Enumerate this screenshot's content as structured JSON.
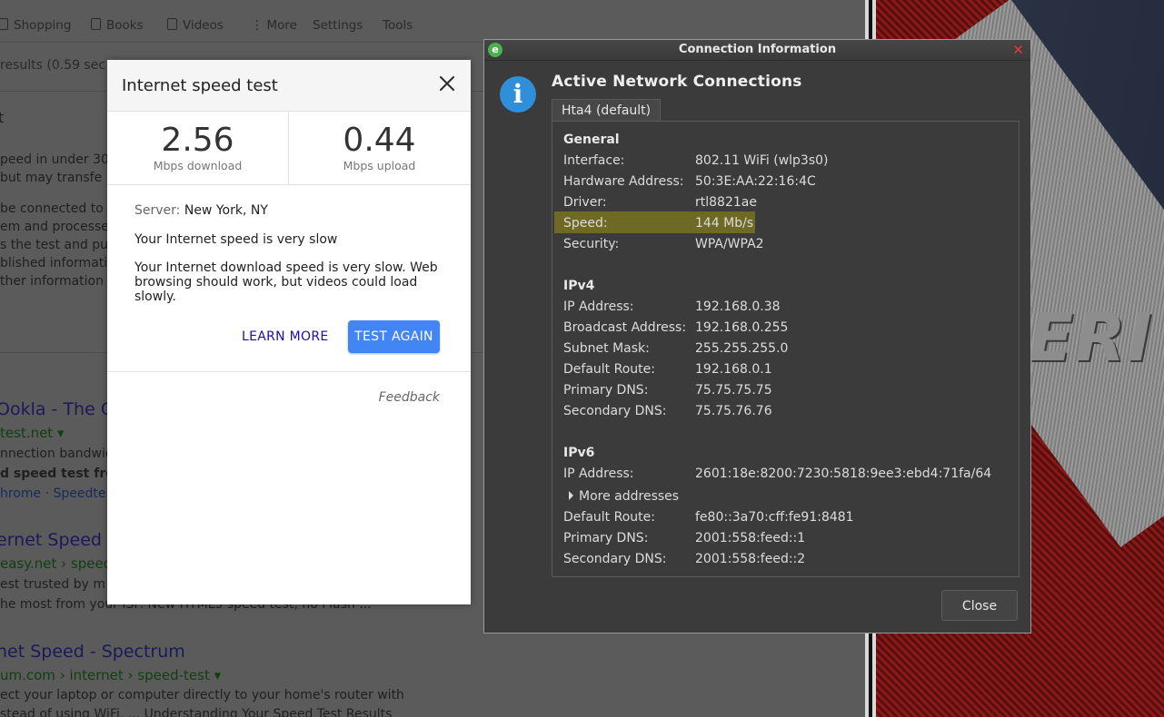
{
  "browser": {
    "tabs": [
      "Shopping",
      "Books",
      "Videos",
      "More",
      "Settings",
      "Tools"
    ],
    "results_stats": "results (0.59 sec",
    "snippet_lines": [
      "peed in under 30",
      "but may transfe",
      "be connected to",
      "em and processe",
      "s the test and pu",
      "blished informatio",
      "ther information"
    ],
    "result1_title": "Ookla - The G",
    "result1_url": "test.net",
    "result1_line1": "nnection bandwid",
    "result1_line2": "d speed test fro",
    "result1_links": "hrome · Speedte",
    "result2_title": "ernet Speed",
    "result2_url": "easy.net › speed",
    "result2_line1": "est trusted by m",
    "result2_line2": "he most from your ISP. New HTML5 speed test, no Flash ...",
    "result3_title": "net Speed - Spectrum",
    "result3_url": "um.com › internet › speed-test",
    "result3_line1": "ect your laptop or computer directly to your home's router with",
    "result3_line2": "stead of using WiFi.  ... Understanding Your Speed Test Results"
  },
  "wallpaper": {
    "logo_text": "ERI"
  },
  "speedtest": {
    "title": "Internet speed test",
    "download_value": "2.56",
    "download_unit": "Mbps download",
    "upload_value": "0.44",
    "upload_unit": "Mbps upload",
    "server_label": "Server:",
    "server_value": "New York, NY",
    "verdict": "Your Internet speed is very slow",
    "detail": "Your Internet download speed is very slow. Web browsing should work, but videos could load slowly.",
    "learn_more": "LEARN MORE",
    "test_again": "TEST AGAIN",
    "feedback": "Feedback"
  },
  "conninfo": {
    "window_title": "Connection Information",
    "heading": "Active Network Connections",
    "tab_label": "Hta4 (default)",
    "general_title": "General",
    "general": [
      {
        "key": "Interface:",
        "value": "802.11 WiFi (wlp3s0)"
      },
      {
        "key": "Hardware Address:",
        "value": "50:3E:AA:22:16:4C"
      },
      {
        "key": "Driver:",
        "value": "rtl8821ae"
      },
      {
        "key": "Speed:",
        "value": "144 Mb/s"
      },
      {
        "key": "Security:",
        "value": "WPA/WPA2"
      }
    ],
    "ipv4_title": "IPv4",
    "ipv4": [
      {
        "key": "IP Address:",
        "value": "192.168.0.38"
      },
      {
        "key": "Broadcast Address:",
        "value": "192.168.0.255"
      },
      {
        "key": "Subnet Mask:",
        "value": "255.255.255.0"
      },
      {
        "key": "Default Route:",
        "value": "192.168.0.1"
      },
      {
        "key": "Primary DNS:",
        "value": "75.75.75.75"
      },
      {
        "key": "Secondary DNS:",
        "value": "75.75.76.76"
      }
    ],
    "ipv6_title": "IPv6",
    "ipv6_ip": {
      "key": "IP Address:",
      "value": "2601:18e:8200:7230:5818:9ee3:ebd4:71fa/64"
    },
    "more_addresses": "More addresses",
    "ipv6": [
      {
        "key": "Default Route:",
        "value": "fe80::3a70:cff:fe91:8481"
      },
      {
        "key": "Primary DNS:",
        "value": "2001:558:feed::1"
      },
      {
        "key": "Secondary DNS:",
        "value": "2001:558:feed::2"
      }
    ],
    "close_label": "Close",
    "highlight_color": "#6e6a26"
  }
}
